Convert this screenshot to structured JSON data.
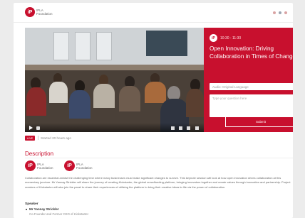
{
  "header": {
    "logo_initials": "iP",
    "logo_text": "IPLA Foundation"
  },
  "video": {
    "controls": [
      "play-icon",
      "volume-icon",
      "subtitles-icon",
      "settings-icon",
      "fullscreen-icon"
    ]
  },
  "session": {
    "logo_initials": "iP",
    "time": "10:30 - 11:30",
    "title": "Open Innovation: Driving Collaboration in Times of Change",
    "language_placeholder": "Audio: Original Language",
    "question_placeholder": "Type your question here",
    "submit_label": "Submit"
  },
  "status": {
    "badge": "LIVE",
    "started": "Started 20 hours ago"
  },
  "description": {
    "title": "Description",
    "partners": [
      {
        "initials": "iP",
        "text": "IPLA Foundation"
      },
      {
        "initials": "iP",
        "text": "IPLA Foundation"
      }
    ],
    "body": "Collaboration are essential amidst the challenging time where many businesses must make significant changes to survive. This keynote session will look at how open innovation drives collaboration at this momentary juncture. Mr Yannay Strickler will share the journey of creating Kickstarter, the global crowdfunding platform, bringing innovators together and create values through innovation and partnership. Project creators of Kickstarter will also join the panel to share their experiences of utilising the platform to bring their creative ideas to life via the power of collaboration.",
    "speaker_heading": "Speaker",
    "speaker_name": "Mr Yannay Strickler",
    "speaker_role": "Co-Founder and Former CEO of Kickstarter"
  },
  "colors": {
    "brand_red": "#c8102e",
    "background": "#ececec"
  }
}
